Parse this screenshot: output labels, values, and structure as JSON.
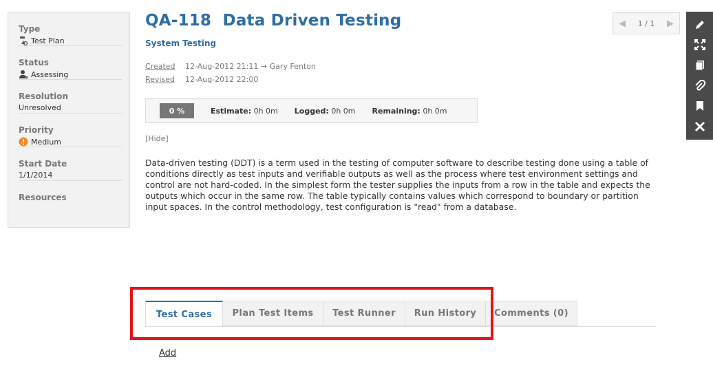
{
  "sidebar": {
    "type": {
      "label": "Type",
      "value": "Test Plan",
      "icon": "test-plan-icon"
    },
    "status": {
      "label": "Status",
      "value": "Assessing",
      "icon": "person-icon"
    },
    "resolution": {
      "label": "Resolution",
      "value": "Unresolved"
    },
    "priority": {
      "label": "Priority",
      "value": "Medium",
      "icon": "exclamation-icon",
      "icon_color": "#f08a24"
    },
    "start_date": {
      "label": "Start Date",
      "value": "1/1/2014"
    },
    "resources": {
      "label": "Resources"
    }
  },
  "header": {
    "title": "QA-118  Data Driven Testing",
    "subtitle": "System Testing",
    "created_label": "Created",
    "created_value": "12-Aug-2012 21:11 → Gary Fenton",
    "revised_label": "Revised",
    "revised_value": "12-Aug-2012 22:00"
  },
  "pager": {
    "text": "1 / 1",
    "prev_icon": "◀",
    "next_icon": "▶"
  },
  "toolbar": {
    "icons": [
      "pencil-icon",
      "expand-icon",
      "copy-icon",
      "paperclip-icon",
      "bookmark-icon",
      "close-icon"
    ]
  },
  "progress": {
    "percent": "0 %",
    "estimate_label": "Estimate:",
    "estimate_value": "0h 0m",
    "logged_label": "Logged:",
    "logged_value": "0h 0m",
    "remaining_label": "Remaining:",
    "remaining_value": "0h 0m"
  },
  "hide_link": "[Hide]",
  "description": "Data-driven testing (DDT) is a term used in the testing of computer software to describe testing done using a table of conditions directly as test inputs and verifiable outputs as well as the process where test environment settings and control are not hard-coded. In the simplest form the tester supplies the inputs from a row in the table and expects the outputs which occur in the same row. The table typically contains values which correspond to boundary or partition input spaces. In the control methodology, test configuration is \"read\" from a database.",
  "tabs": [
    "Test Cases",
    "Plan Test Items",
    "Test Runner",
    "Run History",
    "Comments (0)"
  ],
  "add_link": "Add",
  "colors": {
    "accent": "#2e6da4",
    "highlight": "#e0141a"
  }
}
